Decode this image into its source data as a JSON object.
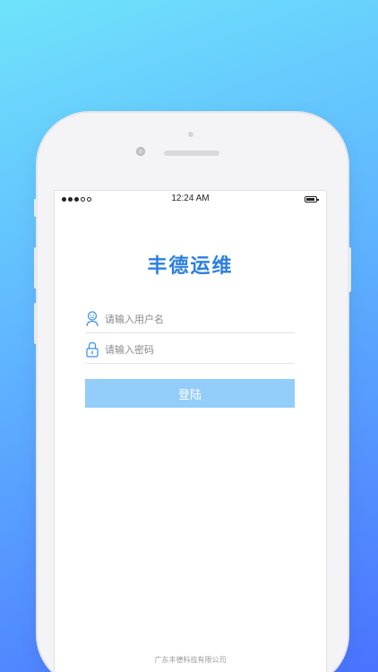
{
  "status_bar": {
    "time": "12:24 AM"
  },
  "app": {
    "title": "丰德运维"
  },
  "login_form": {
    "username_placeholder": "请输入用户名",
    "password_placeholder": "请输入密码",
    "login_label": "登陆"
  },
  "footer": {
    "company": "广东丰德科技有限公司"
  },
  "colors": {
    "accent": "#2b7fe0",
    "button_disabled": "#93cdfa",
    "icon": "#3a8fe6"
  },
  "icons": [
    "user-icon",
    "lock-icon",
    "signal-icon",
    "battery-icon"
  ]
}
